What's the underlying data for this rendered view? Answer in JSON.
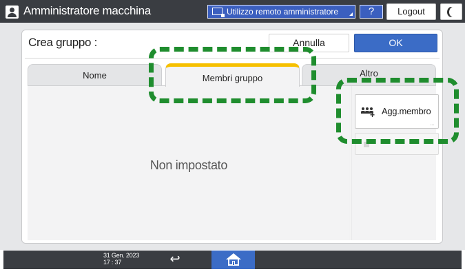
{
  "header": {
    "title": "Amministratore macchina",
    "remote_label": "Utilizzo remoto amministratore",
    "help_label": "?",
    "logout_label": "Logout"
  },
  "dialog": {
    "title": "Crea gruppo :",
    "cancel_label": "Annulla",
    "ok_label": "OK"
  },
  "tabs": [
    {
      "label": "Nome",
      "selected": false
    },
    {
      "label": "Membri gruppo",
      "selected": true
    },
    {
      "label": "Altro",
      "selected": false
    }
  ],
  "content": {
    "empty_text": "Non impostato",
    "add_member_label": "Agg.membro"
  },
  "footer": {
    "date": "31 Gen. 2023",
    "time": "17 : 37"
  },
  "icons": [
    "user-icon",
    "remote-admin-icon",
    "moon-icon",
    "add-member-icon",
    "back-arrow-icon",
    "home-icon"
  ],
  "colors": {
    "accent_blue": "#3b6cc6",
    "tab_selected_bar": "#f6c000",
    "callout_green": "#1f8d2e",
    "header_bg": "#3a3d42"
  }
}
